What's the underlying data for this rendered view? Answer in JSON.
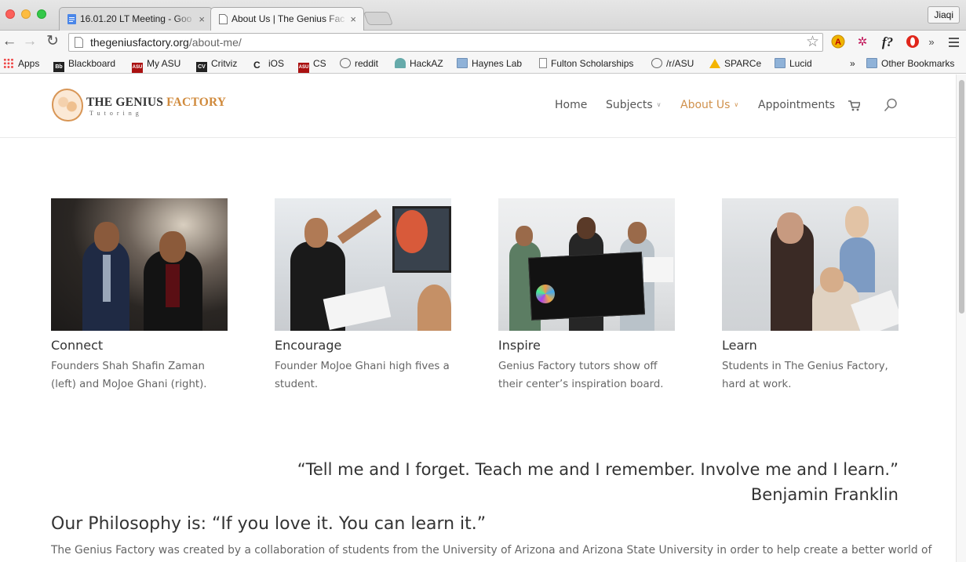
{
  "browser": {
    "tabs": [
      {
        "title": "16.01.20 LT Meeting - Goo"
      },
      {
        "title": "About Us | The Genius Fac"
      }
    ],
    "user": "Jiaqi",
    "url": {
      "host": "thegeniusfactory.org",
      "path": "/about-me/"
    },
    "extensions": [
      "adblock-icon",
      "extension-icon",
      "f?",
      "opera-icon"
    ],
    "overflow": "»",
    "bookmarks": [
      {
        "label": "Apps",
        "icon": "apps-icon"
      },
      {
        "label": "Blackboard",
        "icon": "blackboard-icon"
      },
      {
        "label": "My ASU",
        "icon": "asu-icon"
      },
      {
        "label": "Critviz",
        "icon": "critviz-icon"
      },
      {
        "label": "iOS",
        "icon": "c-icon"
      },
      {
        "label": "CS",
        "icon": "asu-icon"
      },
      {
        "label": "reddit",
        "icon": "reddit-icon"
      },
      {
        "label": "HackAZ",
        "icon": "hackaz-icon"
      },
      {
        "label": "Haynes Lab",
        "icon": "folder-icon"
      },
      {
        "label": "Fulton Scholarships",
        "icon": "page-icon"
      },
      {
        "label": "/r/ASU",
        "icon": "reddit-icon"
      },
      {
        "label": "SPARCe",
        "icon": "drive-icon"
      },
      {
        "label": "Lucid",
        "icon": "folder-icon"
      }
    ],
    "bookmarks_overflow": "»",
    "other_bookmarks": "Other Bookmarks"
  },
  "site": {
    "logo": {
      "name_plain": "THE GENIUS ",
      "name_accent": "FACTORY",
      "tagline": "Tutoring"
    },
    "nav": [
      {
        "label": "Home"
      },
      {
        "label": "Subjects",
        "caret": "∨"
      },
      {
        "label": "About Us",
        "caret": "∨"
      },
      {
        "label": "Appointments"
      }
    ],
    "accent_color": "#d0914c",
    "cards": [
      {
        "title": "Connect",
        "caption": "Founders Shah Shafin Zaman (left) and MoJoe Ghani (right)."
      },
      {
        "title": "Encourage",
        "caption": "Founder MoJoe Ghani high fives a student."
      },
      {
        "title": "Inspire",
        "caption": "Genius Factory tutors show off their center’s inspiration board."
      },
      {
        "title": "Learn",
        "caption": "Students in The Genius Factory, hard at work."
      }
    ],
    "quote": {
      "text": "“Tell me and I forget. Teach me and I remember. Involve me and I learn.”",
      "author": "Benjamin Franklin"
    },
    "philosophy": "Our Philosophy is: “If you love it. You can learn it.”",
    "body": "The Genius Factory was created by a collaboration of students from the University of Arizona and Arizona State University in order to help create a better world of"
  }
}
